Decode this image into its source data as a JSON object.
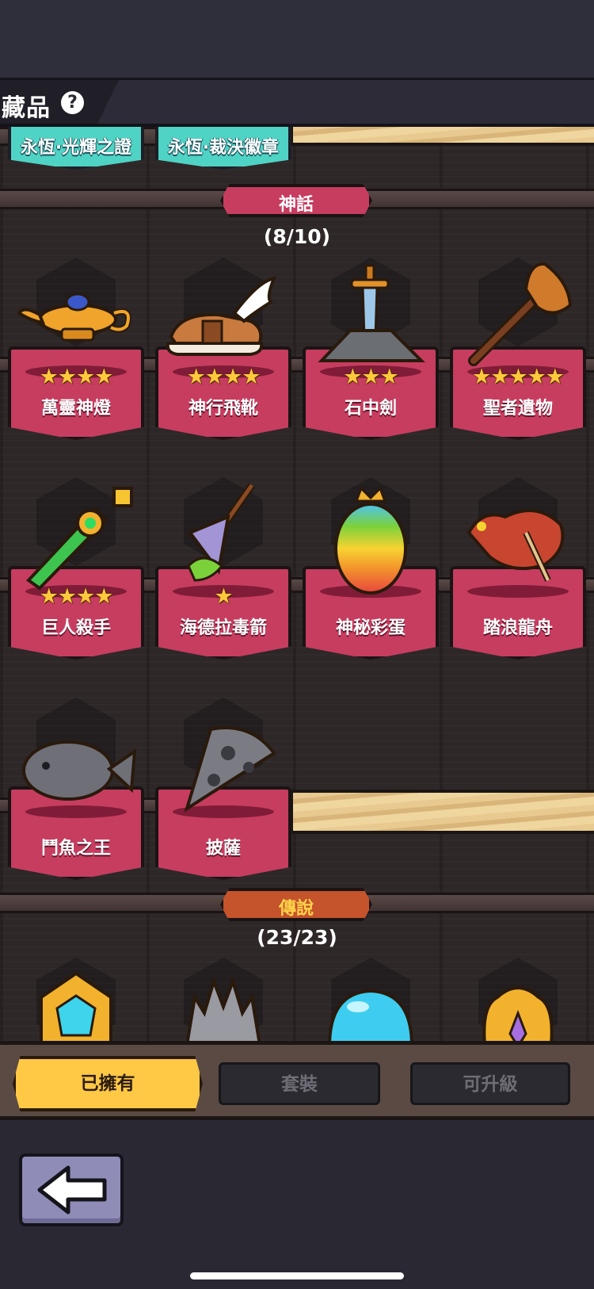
{
  "header": {
    "title": "藏品",
    "help_icon": "?"
  },
  "top_badges": [
    {
      "label": "永恆·光輝之證"
    },
    {
      "label": "永恆·裁決徽章"
    }
  ],
  "sections": [
    {
      "banner": "神話",
      "count": "(8/10)",
      "items": [
        {
          "name": "萬靈神燈",
          "stars": "★★★★",
          "icon": "magic-lamp-icon"
        },
        {
          "name": "神行飛靴",
          "stars": "★★★★",
          "icon": "winged-boots-icon"
        },
        {
          "name": "石中劍",
          "stars": "★★★",
          "icon": "sword-in-stone-icon"
        },
        {
          "name": "聖者遺物",
          "stars": "★★★★★",
          "icon": "relic-staff-icon"
        },
        {
          "name": "巨人殺手",
          "stars": "★★★★",
          "icon": "green-blade-icon"
        },
        {
          "name": "海德拉毒箭",
          "stars": "★",
          "icon": "hydra-arrow-icon"
        },
        {
          "name": "神秘彩蛋",
          "stars": "",
          "icon": "rainbow-egg-icon"
        },
        {
          "name": "踏浪龍舟",
          "stars": "",
          "icon": "dragon-boat-icon"
        },
        {
          "name": "鬥魚之王",
          "stars": "",
          "icon": "stone-fish-icon"
        },
        {
          "name": "披薩",
          "stars": "",
          "icon": "stone-pizza-icon"
        }
      ]
    },
    {
      "banner": "傳說",
      "count": "(23/23)",
      "items": [
        {
          "icon": "gem-shield-icon"
        },
        {
          "icon": "iron-crown-icon"
        },
        {
          "icon": "crystal-dome-icon"
        },
        {
          "icon": "gold-crown-icon"
        }
      ]
    }
  ],
  "tabs": [
    {
      "label": "已擁有"
    },
    {
      "label": "套裝"
    },
    {
      "label": "可升級"
    }
  ],
  "colors": {
    "mythic_plate": "#c73d5f",
    "legend_banner": "#c5532b",
    "active_tab": "#ffc845",
    "badge_teal": "#4fd3c4"
  }
}
